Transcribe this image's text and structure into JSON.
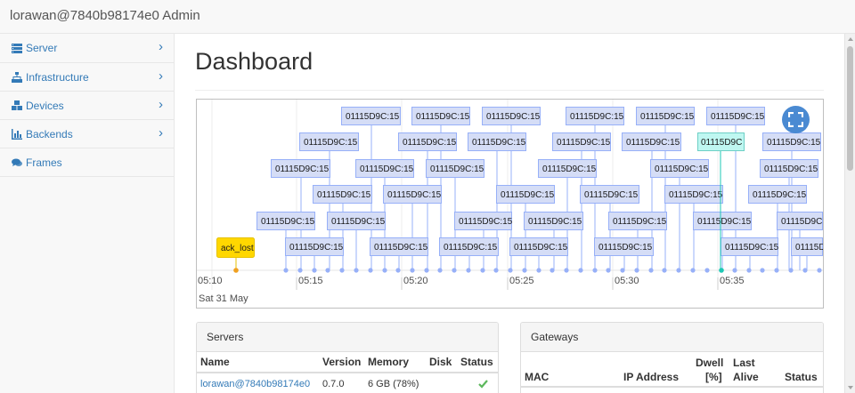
{
  "app": {
    "brand": "lorawan@7840b98174e0 Admin"
  },
  "sidebar": {
    "items": [
      {
        "label": "Server",
        "icon": "server-icon",
        "chevron": "›"
      },
      {
        "label": "Infrastructure",
        "icon": "sitemap-icon",
        "chevron": "›"
      },
      {
        "label": "Devices",
        "icon": "cubes-icon",
        "chevron": "›"
      },
      {
        "label": "Backends",
        "icon": "bar-chart-icon",
        "chevron": "›"
      },
      {
        "label": "Frames",
        "icon": "comments-icon",
        "chevron": ""
      }
    ]
  },
  "main": {
    "title": "Dashboard"
  },
  "timeline": {
    "date_label": "Sat 31 May",
    "ticks": [
      "05:10",
      "05:15",
      "05:20",
      "05:25",
      "05:30",
      "05:35"
    ],
    "event_label": "01115D9C:15",
    "selected_label": "01115D9C",
    "special_label": "ack_lost",
    "colors": {
      "item_bg": "#d5ddf6",
      "item_border": "#97b0f8",
      "selected_bg": "#bff7f1",
      "selected_border": "#6dcfc5",
      "special_bg": "#ffd700",
      "special_border": "#e6c200",
      "dot": "#97b0f8"
    }
  },
  "servers": {
    "title": "Servers",
    "columns": [
      "Name",
      "Version",
      "Memory",
      "Disk",
      "Status"
    ],
    "rows": [
      {
        "name": "lorawan@7840b98174e0",
        "version": "0.7.0",
        "memory": "6 GB (78%)",
        "disk": "",
        "status": "ok"
      }
    ]
  },
  "gateways": {
    "title": "Gateways",
    "columns": [
      "MAC",
      "IP Address",
      "Dwell [%]",
      "Last Alive",
      "Status"
    ],
    "dwell_line1": "Dwell",
    "dwell_line2": "[%]",
    "last_line1": "Last",
    "last_line2": "Alive"
  }
}
